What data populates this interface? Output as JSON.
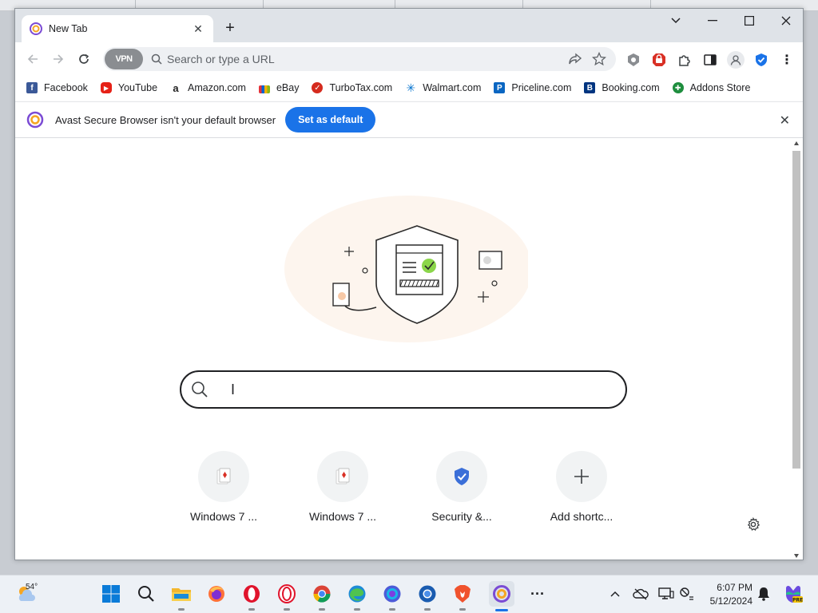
{
  "browser": {
    "tab": {
      "title": "New Tab"
    },
    "omnibox": {
      "placeholder": "Search or type a URL",
      "vpn_label": "VPN"
    },
    "bookmarks": [
      {
        "label": "Facebook",
        "icon": "facebook-icon",
        "color": "#3b5998"
      },
      {
        "label": "YouTube",
        "icon": "youtube-icon",
        "color": "#e62117"
      },
      {
        "label": "Amazon.com",
        "icon": "amazon-icon",
        "color": "#222222"
      },
      {
        "label": "eBay",
        "icon": "ebay-icon",
        "color": "#e53238"
      },
      {
        "label": "TurboTax.com",
        "icon": "turbotax-icon",
        "color": "#d52b1e"
      },
      {
        "label": "Walmart.com",
        "icon": "walmart-icon",
        "color": "#0071ce"
      },
      {
        "label": "Priceline.com",
        "icon": "priceline-icon",
        "color": "#0a66c2"
      },
      {
        "label": "Booking.com",
        "icon": "booking-icon",
        "color": "#003580"
      },
      {
        "label": "Addons Store",
        "icon": "addons-store-icon",
        "color": "#1e8e3e"
      }
    ],
    "infobar": {
      "message": "Avast Secure Browser isn't your default browser",
      "button": "Set as default"
    },
    "shortcuts": [
      {
        "label": "Windows 7 ...",
        "icon": "cards-icon"
      },
      {
        "label": "Windows 7 ...",
        "icon": "cards-icon"
      },
      {
        "label": "Security &...",
        "icon": "shield-icon"
      },
      {
        "label": "Add shortc...",
        "icon": "plus-icon"
      }
    ],
    "accent_color": "#1a73e8"
  },
  "taskbar": {
    "weather_temp": "54°",
    "time": "6:07 PM",
    "date": "5/12/2024"
  }
}
